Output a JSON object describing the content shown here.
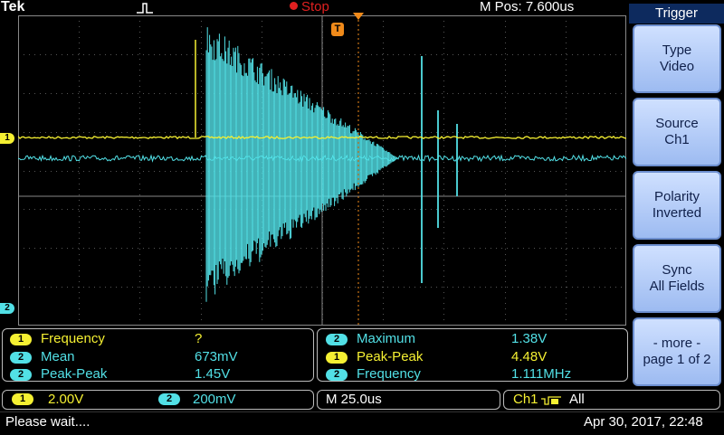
{
  "header": {
    "brand": "Tek",
    "run_state": "Stop",
    "m_pos": "M Pos: 7.600us"
  },
  "markers": {
    "trigger_marker": "T",
    "ch1_marker": "1",
    "ch2_marker": "2"
  },
  "side_menu": {
    "title": "Trigger",
    "buttons": [
      {
        "line1": "Type",
        "line2": "Video"
      },
      {
        "line1": "Source",
        "line2": "Ch1"
      },
      {
        "line1": "Polarity",
        "line2": "Inverted"
      },
      {
        "line1": "Sync",
        "line2": "All Fields"
      },
      {
        "line1": "- more -",
        "line2": "page 1 of 2"
      }
    ]
  },
  "measurements_left": [
    {
      "channel": "1",
      "label": "Frequency",
      "value": "?"
    },
    {
      "channel": "2",
      "label": "Mean",
      "value": "673mV"
    },
    {
      "channel": "2",
      "label": "Peak-Peak",
      "value": "1.45V"
    }
  ],
  "measurements_right": [
    {
      "channel": "2",
      "label": "Maximum",
      "value": "1.38V"
    },
    {
      "channel": "1",
      "label": "Peak-Peak",
      "value": "4.48V"
    },
    {
      "channel": "2",
      "label": "Frequency",
      "value": "1.111MHz"
    }
  ],
  "settings": {
    "ch1_channel": "1",
    "ch1_scale": "2.00V",
    "ch2_channel": "2",
    "ch2_scale": "200mV",
    "timebase": "M 25.0us",
    "trigger_source": "Ch1",
    "trigger_field": "All"
  },
  "status": {
    "message": "Please wait....",
    "datetime": "Apr 30, 2017, 22:48"
  },
  "colors": {
    "ch1": "#f5f032",
    "ch2": "#52e0e6",
    "trigger": "#f08a1a",
    "run_stop": "#e02020",
    "menu_button": "#b6ccf8"
  }
}
